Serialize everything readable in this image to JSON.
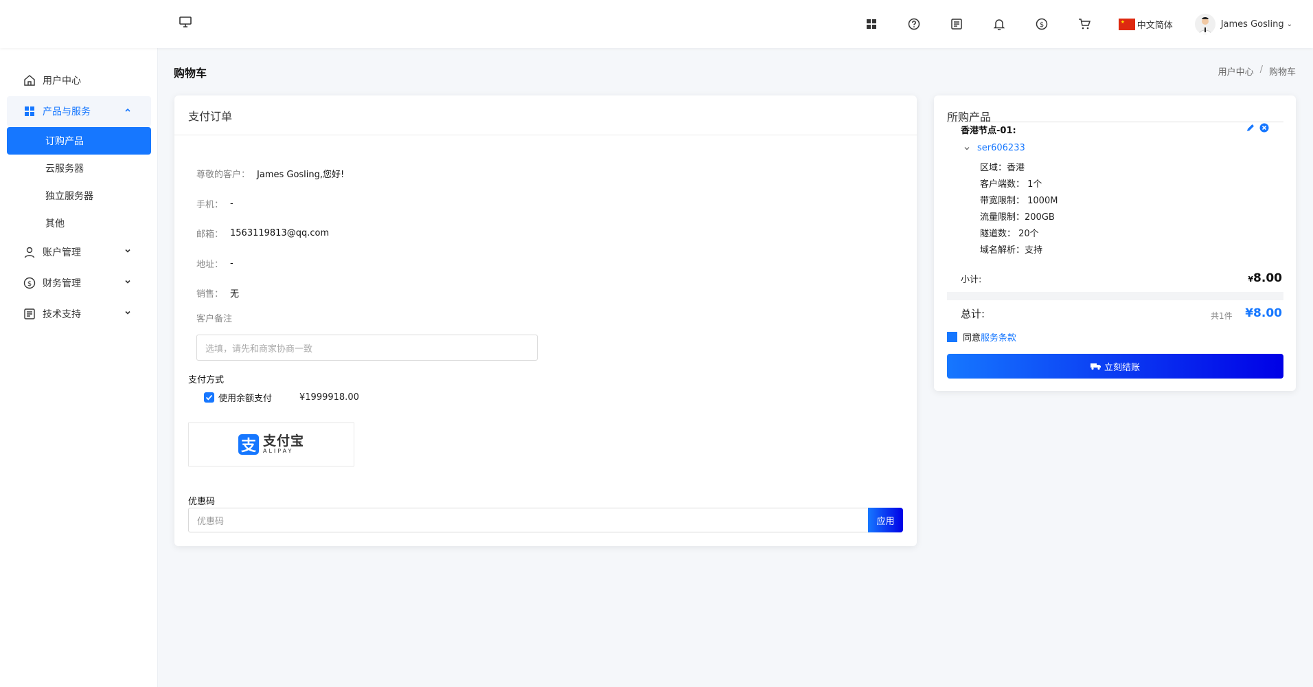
{
  "header": {
    "language": "中文简体",
    "user_name": "James Gosling",
    "icons": [
      "monitor-icon",
      "apps-icon",
      "help-icon",
      "document-icon",
      "bell-icon",
      "dollar-icon",
      "cart-icon"
    ]
  },
  "sidebar": {
    "items": [
      {
        "label": "用户中心",
        "icon": "home-icon"
      },
      {
        "label": "产品与服务",
        "icon": "grid-icon",
        "expanded": true
      },
      {
        "label": "账户管理",
        "icon": "user-icon"
      },
      {
        "label": "财务管理",
        "icon": "dollar-icon"
      },
      {
        "label": "技术支持",
        "icon": "document-icon"
      }
    ],
    "sub_items": [
      {
        "label": "订购产品",
        "active": true
      },
      {
        "label": "云服务器"
      },
      {
        "label": "独立服务器"
      },
      {
        "label": "其他"
      }
    ]
  },
  "page": {
    "title": "购物车",
    "breadcrumb": [
      "用户中心",
      "购物车"
    ]
  },
  "order": {
    "title": "支付订单",
    "greeting_label": "尊敬的客户：",
    "greeting_value": "James Gosling,您好!",
    "phone_label": "手机：",
    "phone_value": "-",
    "email_label": "邮箱：",
    "email_value": "1563119813@qq.com",
    "address_label": "地址：",
    "address_value": "-",
    "sales_label": "销售：",
    "sales_value": "无",
    "note_label": "客户备注",
    "note_placeholder": "选填，请先和商家协商一致",
    "payment_label": "支付方式",
    "balance_label": "使用余额支付",
    "balance_amount": "¥1999918.00",
    "alipay_cn": "支付宝",
    "alipay_en": "ALIPAY",
    "coupon_label": "优惠码",
    "coupon_placeholder": "优惠码",
    "coupon_button": "应用"
  },
  "cart": {
    "title": "所购产品",
    "product_name": "香港节点-01:",
    "server_id": "ser606233",
    "specs": [
      "区域：香港",
      "客户端数：  1个",
      "带宽限制：  1000M",
      "流量限制：200GB",
      "隧道数：  20个",
      "域名解析：支持"
    ],
    "subtotal_label": "小计:",
    "subtotal_currency": "¥",
    "subtotal_value": "8.00",
    "total_label": "总计:",
    "total_count": "共1件",
    "total_value": "¥8.00",
    "agree_prefix": "同意",
    "agree_link": "服务条款",
    "checkout_button": "立刻结账"
  },
  "colors": {
    "accent": "#1677ff",
    "gradient_end": "#0000e6"
  }
}
